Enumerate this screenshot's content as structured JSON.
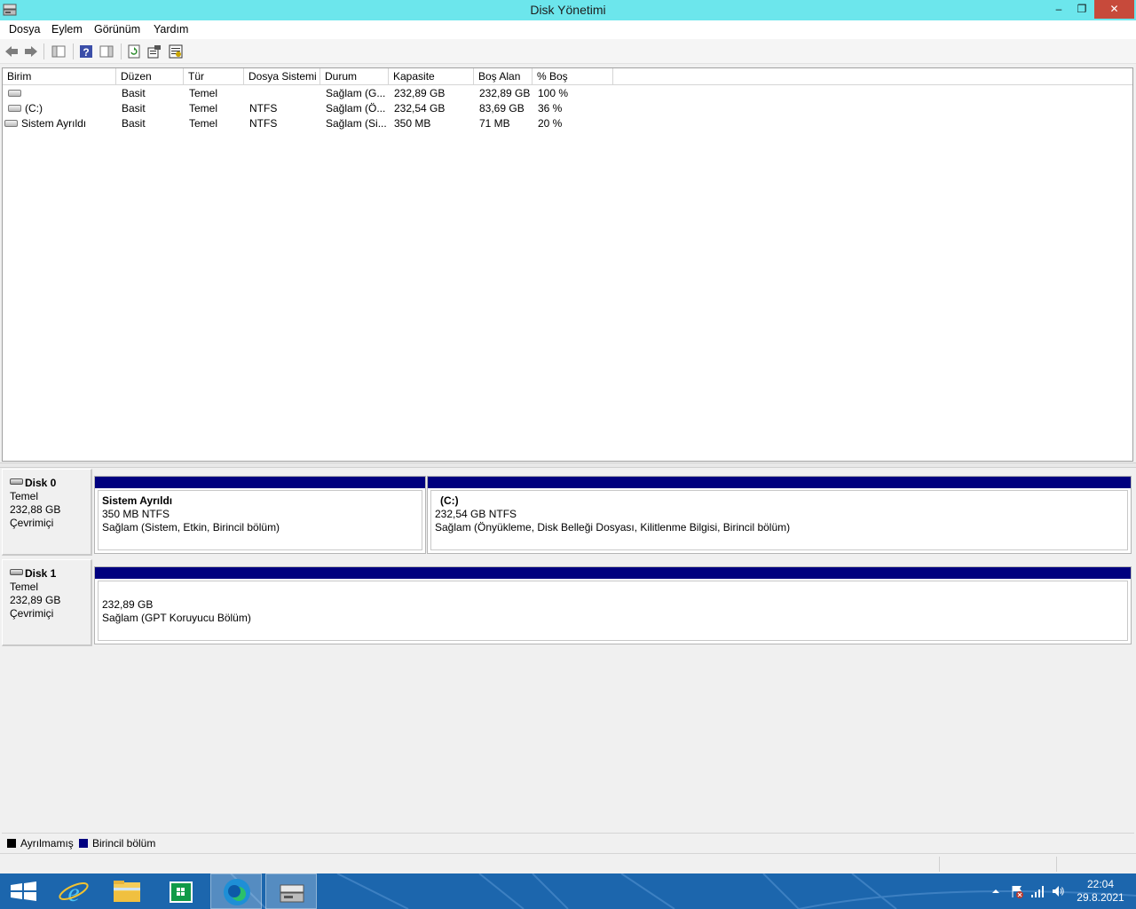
{
  "window": {
    "title": "Disk Yönetimi",
    "controls": {
      "minimize": "‒",
      "maximize": "❐",
      "close": "✕"
    }
  },
  "menu": [
    "Dosya",
    "Eylem",
    "Görünüm",
    "Yardım"
  ],
  "toolbar": {
    "icons": [
      "back-icon",
      "forward-icon",
      "console-tree-icon",
      "help-icon",
      "action-pane-icon",
      "refresh-icon",
      "properties-icon",
      "settings-icon"
    ]
  },
  "volume_list": {
    "columns": [
      "Birim",
      "Düzen",
      "Tür",
      "Dosya Sistemi",
      "Durum",
      "Kapasite",
      "Boş Alan",
      "% Boş"
    ],
    "rows": [
      {
        "birim": "",
        "duzen": "Basit",
        "tur": "Temel",
        "dosya_sistemi": "",
        "durum": "Sağlam (G...",
        "kapasite": "232,89 GB",
        "bos_alan": "232,89 GB",
        "yuzde_bos": "100 %"
      },
      {
        "birim": "(C:)",
        "duzen": "Basit",
        "tur": "Temel",
        "dosya_sistemi": "NTFS",
        "durum": "Sağlam (Ö...",
        "kapasite": "232,54 GB",
        "bos_alan": "83,69 GB",
        "yuzde_bos": "36 %"
      },
      {
        "birim": "Sistem Ayrıldı",
        "duzen": "Basit",
        "tur": "Temel",
        "dosya_sistemi": "NTFS",
        "durum": "Sağlam (Si...",
        "kapasite": "350 MB",
        "bos_alan": "71 MB",
        "yuzde_bos": "20 %"
      }
    ]
  },
  "disks": [
    {
      "name": "Disk 0",
      "type": "Temel",
      "size": "232,88 GB",
      "status": "Çevrimiçi",
      "partitions": [
        {
          "name": "Sistem Ayrıldı",
          "size": "350 MB NTFS",
          "status": "Sağlam (Sistem, Etkin, Birincil bölüm)"
        },
        {
          "name": "(C:)",
          "size": "232,54 GB NTFS",
          "status": "Sağlam (Önyükleme, Disk Belleği Dosyası, Kilitlenme Bilgisi, Birincil bölüm)"
        }
      ]
    },
    {
      "name": "Disk 1",
      "type": "Temel",
      "size": "232,89 GB",
      "status": "Çevrimiçi",
      "partitions": [
        {
          "name": "",
          "size": "232,89 GB",
          "status": "Sağlam (GPT Koruyucu Bölüm)"
        }
      ]
    }
  ],
  "legend": [
    {
      "label": "Ayrılmamış",
      "color": "#000000"
    },
    {
      "label": "Birincil bölüm",
      "color": "#00007f"
    }
  ],
  "taskbar": {
    "apps": [
      "start-icon",
      "internet-explorer-icon",
      "file-explorer-icon",
      "store-icon",
      "edge-icon",
      "disk-management-icon"
    ],
    "tray": [
      "show-hidden-icons-icon",
      "action-center-icon",
      "network-icon",
      "volume-icon"
    ],
    "time": "22:04",
    "date": "29.8.2021"
  }
}
